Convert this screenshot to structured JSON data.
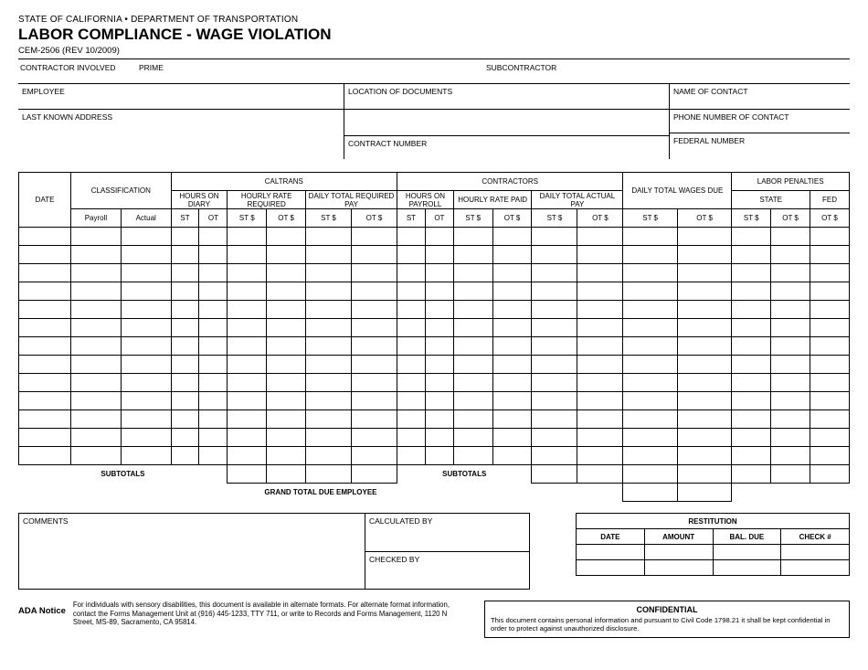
{
  "header": {
    "state_line": "STATE OF CALIFORNIA • DEPARTMENT OF TRANSPORTATION",
    "title": "LABOR COMPLIANCE - WAGE VIOLATION",
    "form_id": "CEM-2506 (REV 10/2009)"
  },
  "contractor_row": {
    "involved_label": "CONTRACTOR INVOLVED",
    "prime_label": "PRIME",
    "sub_label": "SUBCONTRACTOR"
  },
  "info_grid": {
    "employee": "EMPLOYEE",
    "location_docs": "LOCATION OF DOCUMENTS",
    "name_contact": "NAME OF CONTACT",
    "last_addr": "LAST KNOWN ADDRESS",
    "phone_contact": "PHONE NUMBER OF CONTACT",
    "contract_num": "CONTRACT NUMBER",
    "federal_num": "FEDERAL NUMBER"
  },
  "table": {
    "group_caltrans": "CALTRANS",
    "group_contractors": "CONTRACTORS",
    "date": "DATE",
    "classification": "CLASSIFICATION",
    "hours_diary": "HOURS ON DIARY",
    "hourly_rate_req": "HOURLY RATE REQUIRED",
    "daily_total_req": "DAILY TOTAL REQUIRED PAY",
    "hours_payroll": "HOURS ON PAYROLL",
    "hourly_rate_paid": "HOURLY RATE PAID",
    "daily_total_actual": "DAILY TOTAL ACTUAL PAY",
    "daily_total_wages_due": "DAILY TOTAL WAGES DUE",
    "labor_penalties": "LABOR PENALTIES",
    "sub_payroll": "Payroll",
    "sub_actual": "Actual",
    "sub_st": "ST",
    "sub_ot": "OT",
    "sub_st_d": "ST $",
    "sub_ot_d": "OT $",
    "sub_state": "STATE",
    "sub_fed": "FED",
    "subtotals": "SUBTOTALS",
    "grand_total": "GRAND TOTAL DUE EMPLOYEE"
  },
  "bottom": {
    "comments": "COMMENTS",
    "calculated_by": "CALCULATED BY",
    "checked_by": "CHECKED BY"
  },
  "restitution": {
    "title": "RESTITUTION",
    "date": "DATE",
    "amount": "AMOUNT",
    "bal_due": "BAL. DUE",
    "check_no": "CHECK #"
  },
  "ada": {
    "heading": "ADA Notice",
    "body": "For individuals with sensory disabilities, this document is available in alternate formats. For alternate format information, contact the Forms Management Unit at (916) 445-1233, TTY 711, or write to Records and Forms Management, 1120 N Street, MS-89, Sacramento, CA 95814."
  },
  "confidential": {
    "heading": "CONFIDENTIAL",
    "body": "This document contains personal information and pursuant to Civil Code 1798.21 it shall be kept confidential in order to protect against unauthorized disclosure."
  }
}
